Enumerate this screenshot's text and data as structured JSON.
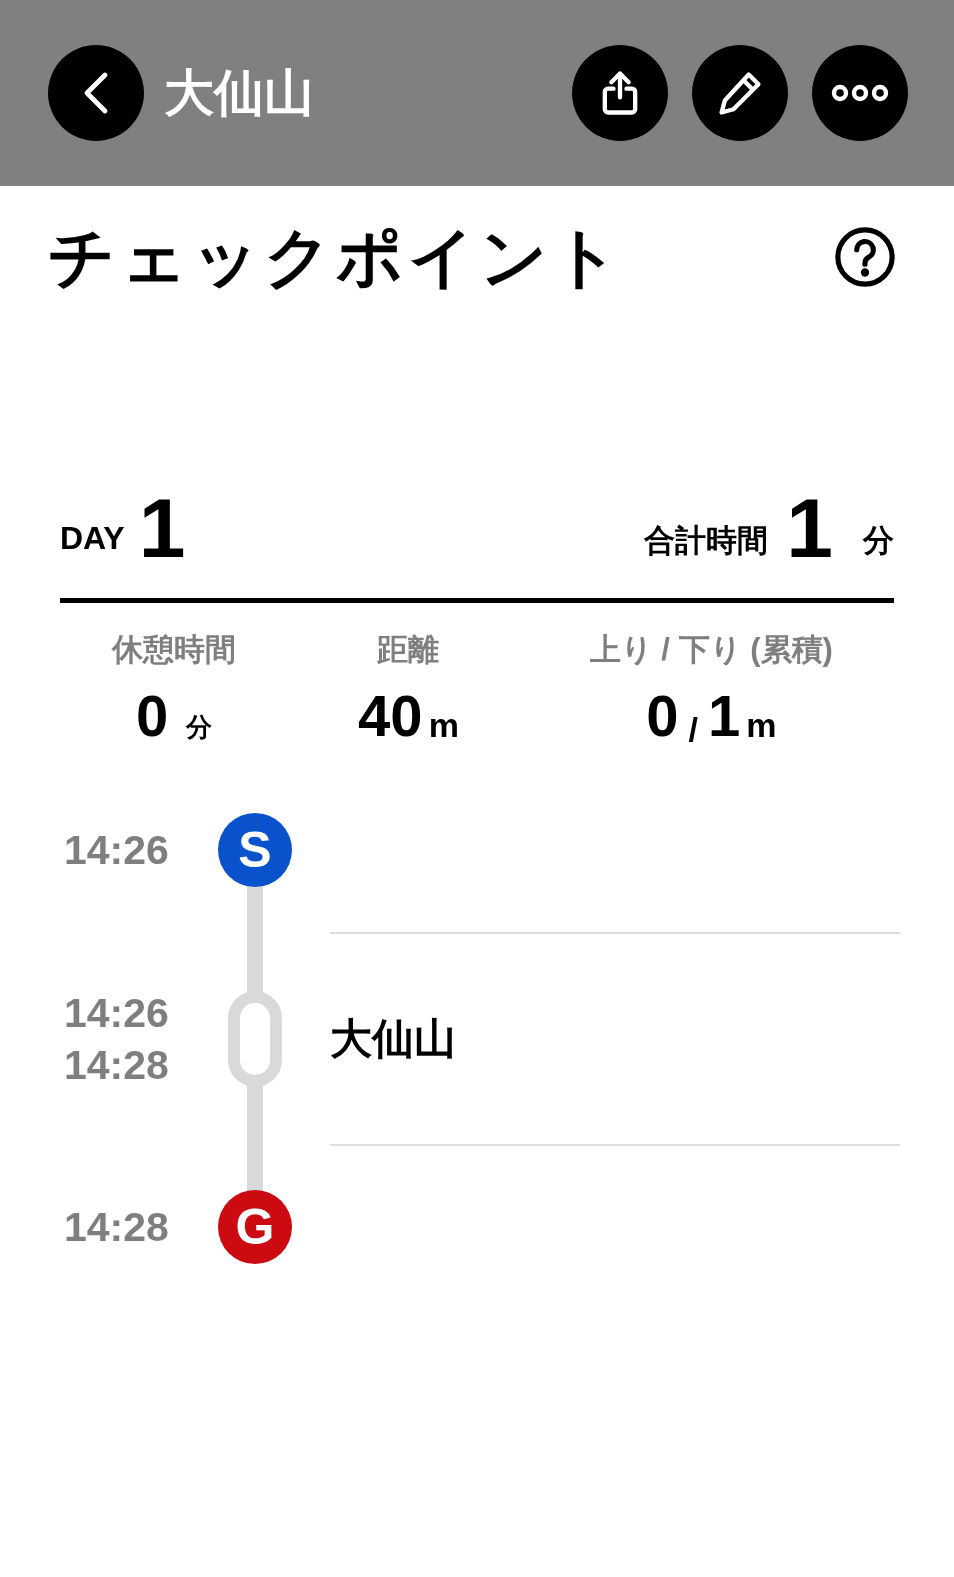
{
  "header": {
    "title": "大仙山",
    "actions": [
      {
        "kind": "share"
      },
      {
        "kind": "edit"
      },
      {
        "kind": "more"
      }
    ]
  },
  "section_title": "チェックポイント",
  "summary": {
    "day_label": "DAY",
    "day": "1",
    "total_label": "合計時間",
    "total": "1",
    "total_unit": "分"
  },
  "stats": [
    {
      "label": "休憩時間",
      "value": "0",
      "unit": "分"
    },
    {
      "label": "距離",
      "value": "40",
      "unit": "m"
    },
    {
      "label": "上り / 下り (累積)",
      "value": "0",
      "separator": "/",
      "value_2": "1",
      "unit": "m"
    }
  ],
  "checkpoints": [
    {
      "kind": "start",
      "marker": "S",
      "color": "#0a52cc",
      "times": [
        "14:26"
      ]
    },
    {
      "kind": "waypoint",
      "name": "大仙山",
      "times": [
        "14:26",
        "14:28"
      ]
    },
    {
      "kind": "goal",
      "marker": "G",
      "color": "#cc0a12",
      "times": [
        "14:28"
      ]
    }
  ]
}
